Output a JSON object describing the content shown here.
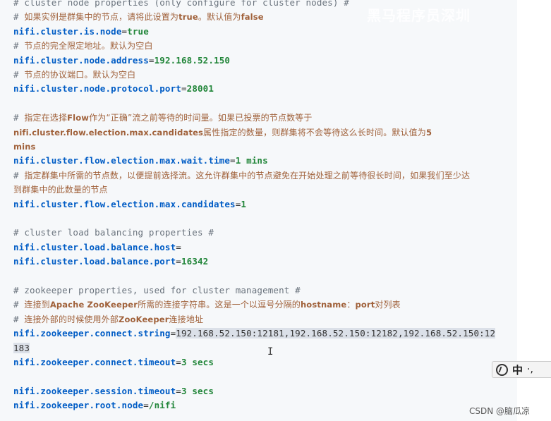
{
  "watermark": "黑马程序员深圳",
  "lines": [
    {
      "seg": [
        {
          "c": "c",
          "t": "# cluster node properties (only configure for cluster nodes) #"
        }
      ]
    },
    {
      "seg": [
        {
          "c": "c",
          "t": "# "
        },
        {
          "c": "cz",
          "t": "如果实例是群集中的节点，请将此设置为"
        },
        {
          "c": "zh",
          "t": "true"
        },
        {
          "c": "cz",
          "t": "。默认值为"
        },
        {
          "c": "zh",
          "t": "false"
        }
      ]
    },
    {
      "seg": [
        {
          "c": "k",
          "t": "nifi.cluster.is.node"
        },
        {
          "c": "op",
          "t": "="
        },
        {
          "c": "v",
          "t": "true"
        }
      ]
    },
    {
      "seg": [
        {
          "c": "c",
          "t": "# "
        },
        {
          "c": "cz",
          "t": "节点的完全限定地址。默认为空白"
        }
      ]
    },
    {
      "seg": [
        {
          "c": "k",
          "t": "nifi.cluster.node.address"
        },
        {
          "c": "op",
          "t": "="
        },
        {
          "c": "v",
          "t": "192.168.52.150"
        }
      ]
    },
    {
      "seg": [
        {
          "c": "c",
          "t": "# "
        },
        {
          "c": "cz",
          "t": "节点的协议端口。默认为空白"
        }
      ]
    },
    {
      "seg": [
        {
          "c": "k",
          "t": "nifi.cluster.node.protocol.port"
        },
        {
          "c": "op",
          "t": "="
        },
        {
          "c": "v",
          "t": "28001"
        }
      ]
    },
    {
      "seg": []
    },
    {
      "seg": [
        {
          "c": "c",
          "t": "# "
        },
        {
          "c": "cz",
          "t": "指定在选择"
        },
        {
          "c": "zh",
          "t": "Flow"
        },
        {
          "c": "cz",
          "t": "作为“正确”流之前等待的时间量。如果已投票的节点数等于"
        }
      ]
    },
    {
      "seg": [
        {
          "c": "zh",
          "t": "nifi.cluster.flow.election.max.candidates"
        },
        {
          "c": "cz",
          "t": "属性指定的数量，则群集将不会等待这么长时间。默认值为"
        },
        {
          "c": "zh",
          "t": "5"
        }
      ]
    },
    {
      "seg": [
        {
          "c": "zh",
          "t": "mins"
        }
      ]
    },
    {
      "seg": [
        {
          "c": "k",
          "t": "nifi.cluster.flow.election.max.wait.time"
        },
        {
          "c": "op",
          "t": "="
        },
        {
          "c": "v",
          "t": "1 mins"
        }
      ]
    },
    {
      "seg": [
        {
          "c": "c",
          "t": "# "
        },
        {
          "c": "cz",
          "t": "指定群集中所需的节点数，以便提前选择流。这允许群集中的节点避免在开始处理之前等待很长时间，如果我们至少达"
        }
      ]
    },
    {
      "seg": [
        {
          "c": "cz",
          "t": "到群集中的此数量的节点"
        }
      ]
    },
    {
      "seg": [
        {
          "c": "k",
          "t": "nifi.cluster.flow.election.max.candidates"
        },
        {
          "c": "op",
          "t": "="
        },
        {
          "c": "v",
          "t": "1"
        }
      ]
    },
    {
      "seg": []
    },
    {
      "seg": [
        {
          "c": "c",
          "t": "# cluster load balancing properties #"
        }
      ]
    },
    {
      "seg": [
        {
          "c": "k",
          "t": "nifi.cluster.load.balance.host"
        },
        {
          "c": "op",
          "t": "="
        }
      ]
    },
    {
      "seg": [
        {
          "c": "k",
          "t": "nifi.cluster.load.balance.port"
        },
        {
          "c": "op",
          "t": "="
        },
        {
          "c": "v",
          "t": "16342"
        }
      ]
    },
    {
      "seg": []
    },
    {
      "seg": [
        {
          "c": "c",
          "t": "# zookeeper properties, used for cluster management #"
        }
      ]
    },
    {
      "seg": [
        {
          "c": "c",
          "t": "# "
        },
        {
          "c": "cz",
          "t": "连接到"
        },
        {
          "c": "zh",
          "t": "Apache ZooKeeper"
        },
        {
          "c": "cz",
          "t": "所需的连接字符串。这是一个以逗号分隔的"
        },
        {
          "c": "zh",
          "t": "hostname"
        },
        {
          "c": "cz",
          "t": "："
        },
        {
          "c": "zh",
          "t": "port"
        },
        {
          "c": "cz",
          "t": "对列表"
        }
      ]
    },
    {
      "seg": [
        {
          "c": "c",
          "t": "# "
        },
        {
          "c": "cz",
          "t": "连接外部的时候使用外部"
        },
        {
          "c": "zh",
          "t": "ZooKeeper"
        },
        {
          "c": "cz",
          "t": "连接地址"
        }
      ]
    },
    {
      "seg": [
        {
          "c": "k",
          "t": "nifi.zookeeper.connect.string"
        },
        {
          "c": "op",
          "t": "="
        },
        {
          "c": "op sel",
          "t": "192.168.52.150:12181,192.168.52.150:12182,192.168.52.150:12"
        }
      ]
    },
    {
      "seg": [
        {
          "c": "op sel",
          "t": "183"
        }
      ]
    },
    {
      "seg": [
        {
          "c": "k",
          "t": "nifi.zookeeper.connect.timeout"
        },
        {
          "c": "op",
          "t": "="
        },
        {
          "c": "v",
          "t": "3 secs"
        }
      ]
    },
    {
      "seg": []
    },
    {
      "seg": [
        {
          "c": "k",
          "t": "nifi.zookeeper.session.timeout"
        },
        {
          "c": "op",
          "t": "="
        },
        {
          "c": "v",
          "t": "3 secs"
        }
      ]
    },
    {
      "seg": [
        {
          "c": "k",
          "t": "nifi.zookeeper.root.node"
        },
        {
          "c": "op",
          "t": "="
        },
        {
          "c": "v",
          "t": "/nifi"
        }
      ]
    }
  ],
  "ime": {
    "lang": "中",
    "punct": "·,"
  },
  "cursor_glyph": "I",
  "footer": "CSDN @脑瓜凉"
}
